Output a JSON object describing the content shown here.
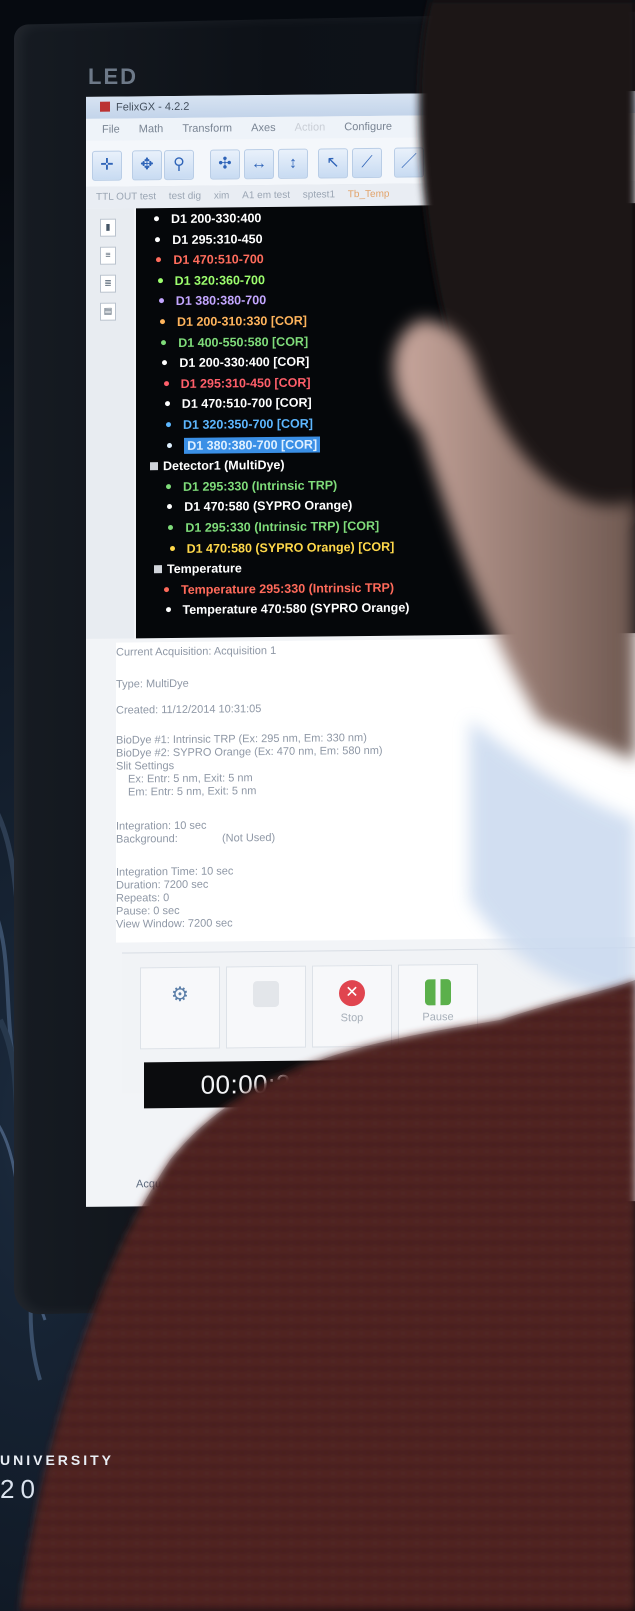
{
  "monitor": {
    "brand": "LED"
  },
  "window": {
    "title": "FelixGX - 4.2.2"
  },
  "menu": [
    "File",
    "Math",
    "Transform",
    "Axes",
    "Action",
    "Configure"
  ],
  "tabs": [
    "TTL OUT test",
    "test dig",
    "xim",
    "A1 em test",
    "sptest1",
    "Tb_Temp"
  ],
  "tree": {
    "channels": [
      {
        "label": "D1 200-330:400",
        "color": "#ffffff"
      },
      {
        "label": "D1 295:310-450",
        "color": "#ffffff"
      },
      {
        "label": "D1 470:510-700",
        "color": "#ff6c5c"
      },
      {
        "label": "D1 320:360-700",
        "color": "#9dff6e"
      },
      {
        "label": "D1 380:380-700",
        "color": "#c3a6ff"
      },
      {
        "label": "D1 200-310:330 [COR]",
        "color": "#ffb45c"
      },
      {
        "label": "D1 400-550:580 [COR]",
        "color": "#7fdc7a"
      },
      {
        "label": "D1 200-330:400 [COR]",
        "color": "#ffffff"
      },
      {
        "label": "D1 295:310-450 [COR]",
        "color": "#ff5f6a"
      },
      {
        "label": "D1 470:510-700 [COR]",
        "color": "#ffffff"
      },
      {
        "label": "D1 320:350-700 [COR]",
        "color": "#5db7ff"
      },
      {
        "label": "D1 380:380-700 [COR]",
        "color": "#dff0ff",
        "selected": true
      }
    ],
    "detector_group": "Detector1 (MultiDye)",
    "detector_items": [
      {
        "label": "D1 295:330 (Intrinsic TRP)",
        "color": "#7fdc7a"
      },
      {
        "label": "D1 470:580 (SYPRO Orange)",
        "color": "#ffffff"
      },
      {
        "label": "D1 295:330 (Intrinsic TRP) [COR]",
        "color": "#7fdc7a"
      },
      {
        "label": "D1 470:580 (SYPRO Orange) [COR]",
        "color": "#ffd84a"
      }
    ],
    "temperature_group": "Temperature",
    "temperature_items": [
      {
        "label": "Temperature 295:330 (Intrinsic TRP)",
        "color": "#ff6a5a"
      },
      {
        "label": "Temperature 470:580 (SYPRO Orange)",
        "color": "#ffffff"
      }
    ]
  },
  "acquisition": {
    "current": "Current Acquisition: Acquisition 1",
    "type": "Type: MultiDye",
    "created": "Created: 11/12/2014 10:31:05",
    "biodye1": "BioDye #1: Intrinsic TRP (Ex: 295 nm, Em: 330 nm)",
    "biodye2": "BioDye #2: SYPRO Orange (Ex: 470 nm, Em: 580 nm)",
    "slit_settings": "Slit Settings",
    "ex_slits": "Ex: Entr: 5 nm, Exit: 5 nm",
    "em_slits": "Em: Entr: 5 nm, Exit: 5 nm",
    "integration": "Integration: 10 sec",
    "background": "Background:",
    "background_value": "(Not Used)",
    "integration_time": "Integration Time: 10 sec",
    "duration": "Duration: 7200 sec",
    "repeats": "Repeats: 0",
    "pause": "Pause: 0 sec",
    "view_window": "View Window: 7200 sec"
  },
  "controls": {
    "stop_label": "Stop",
    "pause_label": "Pause"
  },
  "timer": "00:00:24.96",
  "footer_tab": "Acqu",
  "watermark": {
    "university": "UNIVERSITY",
    "year": "20"
  },
  "colors": {
    "tree_bg": "#05070a",
    "selection": "#3a8fe6",
    "stop_red": "#e0454f",
    "pause_green": "#5bb04b"
  }
}
